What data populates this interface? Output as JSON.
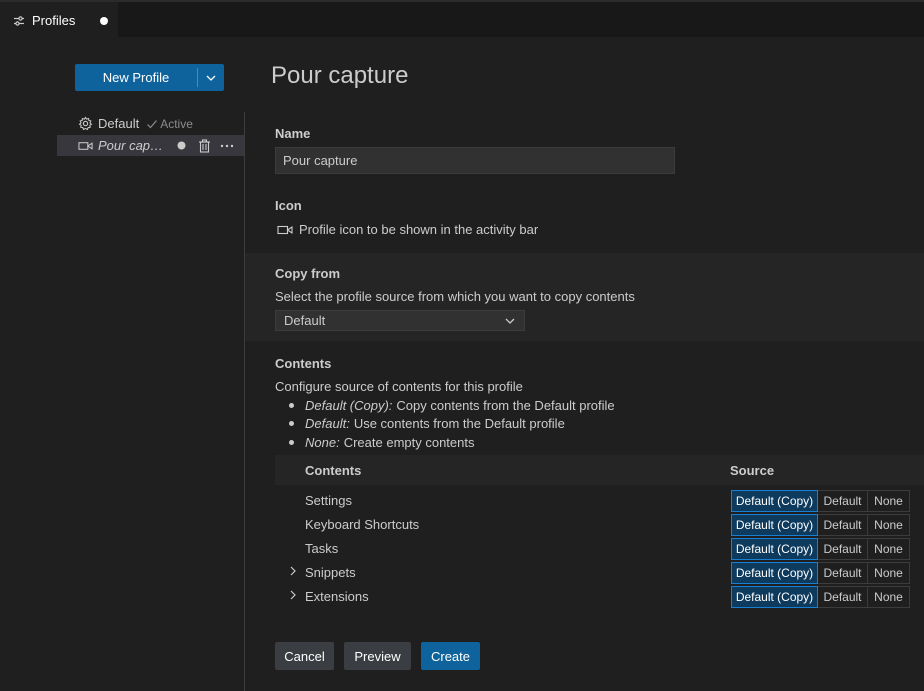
{
  "tab": {
    "label": "Profiles",
    "icon": "settings-sliders-icon"
  },
  "sidebar": {
    "new_profile_label": "New Profile",
    "profiles": [
      {
        "name": "Default",
        "badge": "Active",
        "icon": "gear-icon"
      },
      {
        "name": "Pour capt...",
        "icon": "video-camera-icon"
      }
    ]
  },
  "main": {
    "title": "Pour capture",
    "name": {
      "label": "Name",
      "value": "Pour capture"
    },
    "icon": {
      "label": "Icon",
      "description": "Profile icon to be shown in the activity bar"
    },
    "copy_from": {
      "label": "Copy from",
      "description": "Select the profile source from which you want to copy contents",
      "selected": "Default"
    },
    "contents": {
      "label": "Contents",
      "description": "Configure source of contents for this profile",
      "bullets": [
        {
          "term": "Default (Copy):",
          "text": "Copy contents from the Default profile"
        },
        {
          "term": "Default:",
          "text": "Use contents from the Default profile"
        },
        {
          "term": "None:",
          "text": "Create empty contents"
        }
      ],
      "headers": {
        "contents": "Contents",
        "source": "Source"
      },
      "options": [
        "Default (Copy)",
        "Default",
        "None"
      ],
      "rows": [
        {
          "label": "Settings",
          "expandable": false,
          "selected": "Default (Copy)"
        },
        {
          "label": "Keyboard Shortcuts",
          "expandable": false,
          "selected": "Default (Copy)"
        },
        {
          "label": "Tasks",
          "expandable": false,
          "selected": "Default (Copy)"
        },
        {
          "label": "Snippets",
          "expandable": true,
          "selected": "Default (Copy)"
        },
        {
          "label": "Extensions",
          "expandable": true,
          "selected": "Default (Copy)"
        }
      ]
    },
    "buttons": {
      "cancel": "Cancel",
      "preview": "Preview",
      "create": "Create"
    }
  },
  "colors": {
    "accent": "#0e639c",
    "background": "#1f1f1f",
    "selected_row": "#37373d",
    "segment_on": "#0e3a5e"
  }
}
